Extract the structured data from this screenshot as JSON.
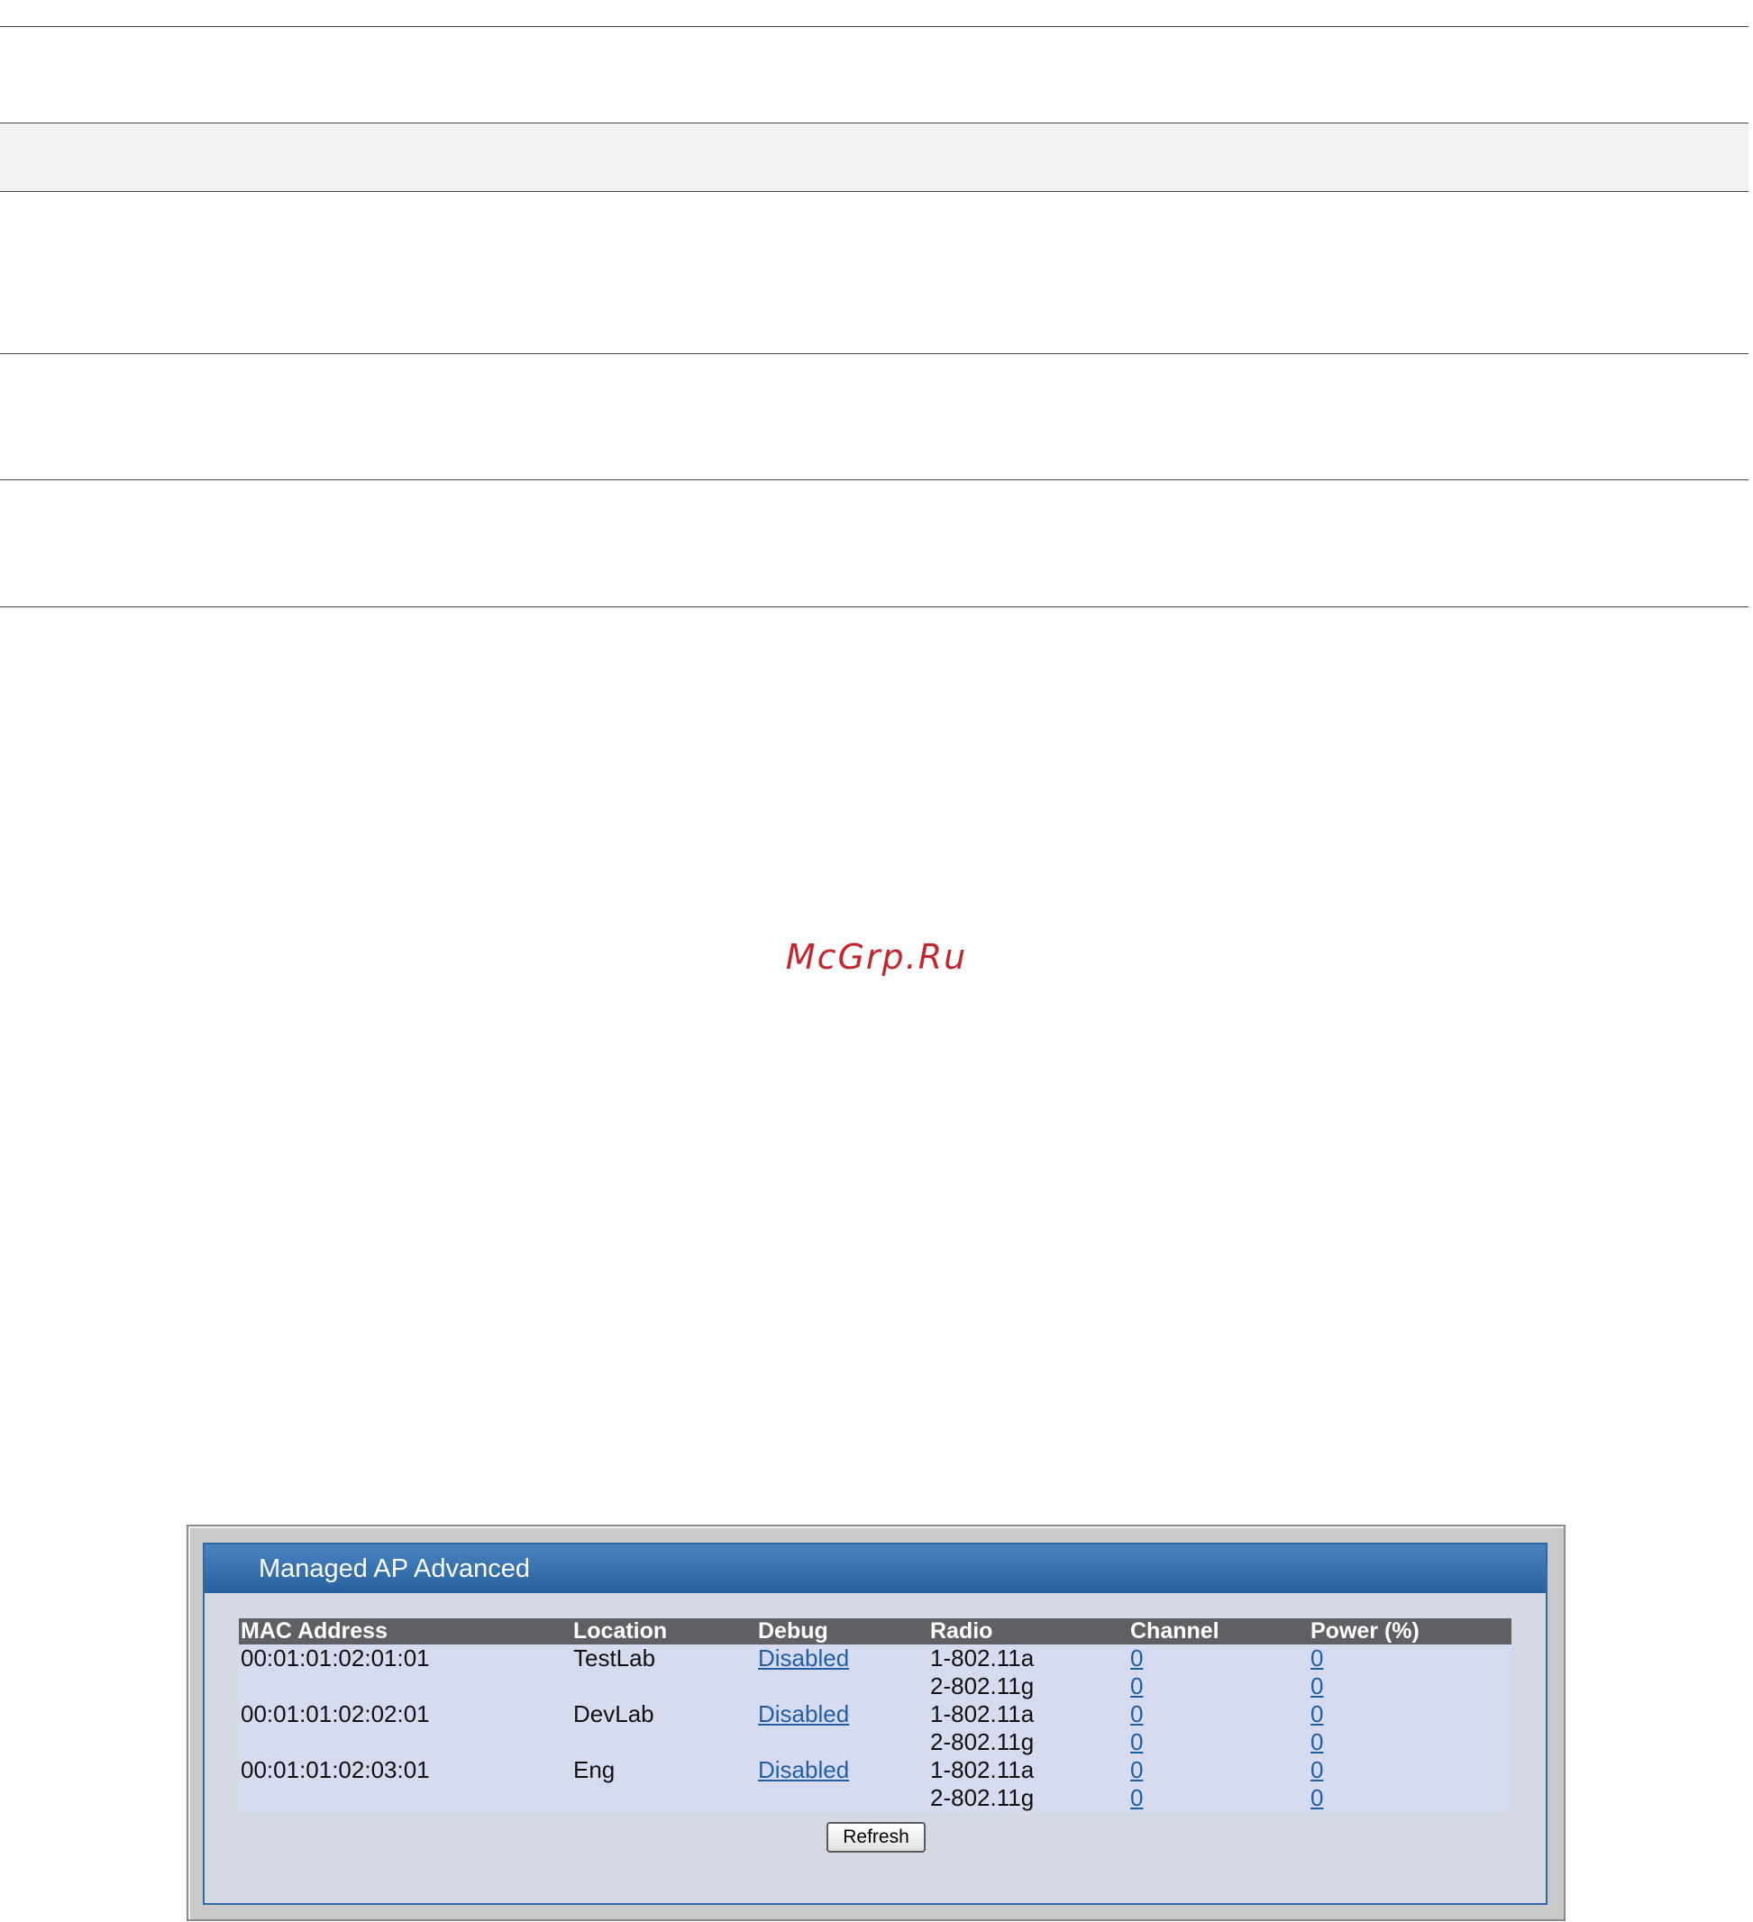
{
  "watermark": "McGrp.Ru",
  "panel": {
    "title": "Managed AP Advanced",
    "columns": [
      "MAC Address",
      "Location",
      "Debug",
      "Radio",
      "Channel",
      "Power (%)"
    ],
    "access_points": [
      {
        "mac": "00:01:01:02:01:01",
        "location": "TestLab",
        "debug": "Disabled",
        "radios": [
          {
            "radio": "1-802.11a",
            "channel": "0",
            "power": "0"
          },
          {
            "radio": "2-802.11g",
            "channel": "0",
            "power": "0"
          }
        ]
      },
      {
        "mac": "00:01:01:02:02:01",
        "location": "DevLab",
        "debug": "Disabled",
        "radios": [
          {
            "radio": "1-802.11a",
            "channel": "0",
            "power": "0"
          },
          {
            "radio": "2-802.11g",
            "channel": "0",
            "power": "0"
          }
        ]
      },
      {
        "mac": "00:01:01:02:03:01",
        "location": "Eng",
        "debug": "Disabled",
        "radios": [
          {
            "radio": "1-802.11a",
            "channel": "0",
            "power": "0"
          },
          {
            "radio": "2-802.11g",
            "channel": "0",
            "power": "0"
          }
        ]
      }
    ],
    "refresh_label": "Refresh"
  }
}
